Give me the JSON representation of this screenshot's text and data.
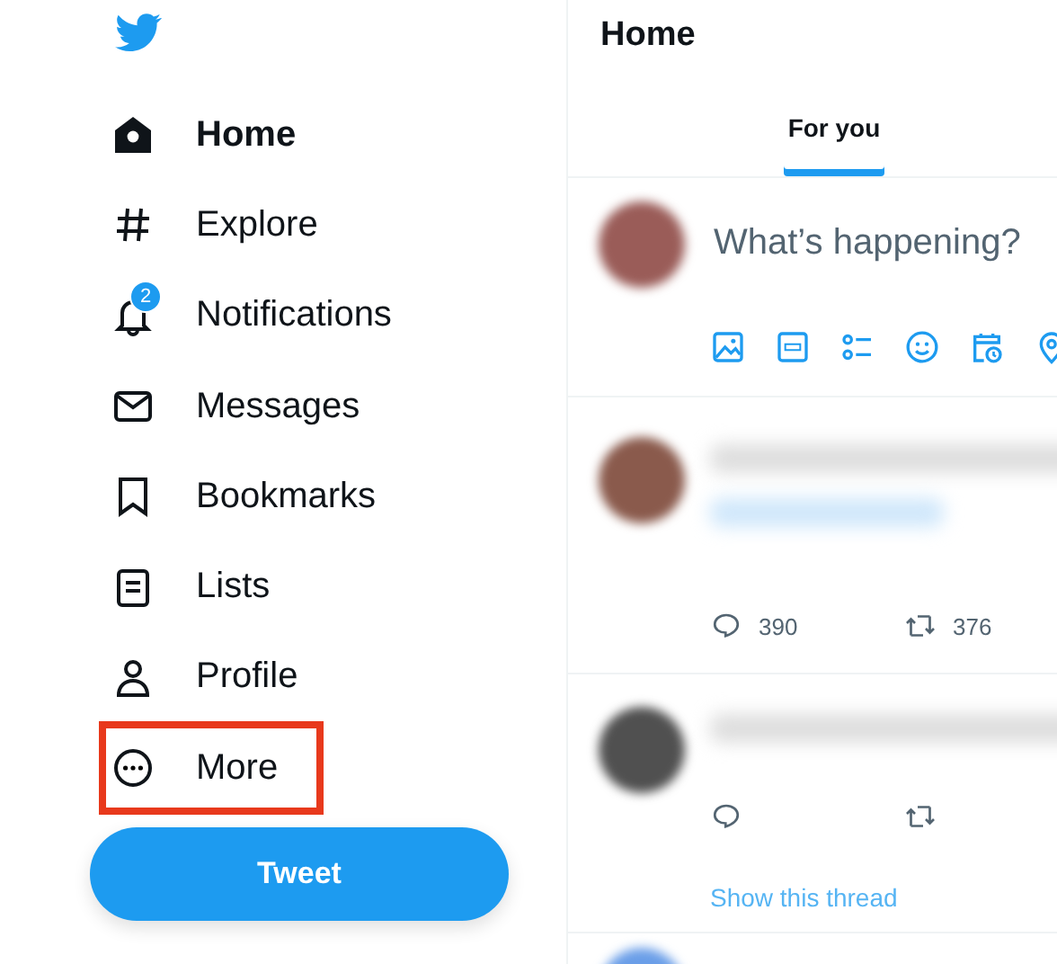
{
  "sidebar": {
    "items": [
      {
        "kind": "home",
        "label": "Home",
        "selected": true,
        "highlighted": false
      },
      {
        "kind": "explore",
        "label": "Explore",
        "selected": false,
        "highlighted": false
      },
      {
        "kind": "notifications",
        "label": "Notifications",
        "selected": false,
        "highlighted": false,
        "badge": "2"
      },
      {
        "kind": "messages",
        "label": "Messages",
        "selected": false,
        "highlighted": false
      },
      {
        "kind": "bookmarks",
        "label": "Bookmarks",
        "selected": false,
        "highlighted": false
      },
      {
        "kind": "lists",
        "label": "Lists",
        "selected": false,
        "highlighted": false
      },
      {
        "kind": "profile",
        "label": "Profile",
        "selected": false,
        "highlighted": false
      },
      {
        "kind": "more",
        "label": "More",
        "selected": false,
        "highlighted": true
      }
    ],
    "tweet_button": "Tweet"
  },
  "main": {
    "title": "Home",
    "tabs": [
      {
        "label": "For you",
        "selected": true
      }
    ],
    "composer": {
      "placeholder": "What’s happening?"
    },
    "tweets": [
      {
        "color": "#8a5a4c",
        "replies": "390",
        "retweets": "376"
      },
      {
        "color": "#505050",
        "show_thread": "Show this thread"
      },
      {
        "color": "#6a9ee8"
      }
    ]
  }
}
